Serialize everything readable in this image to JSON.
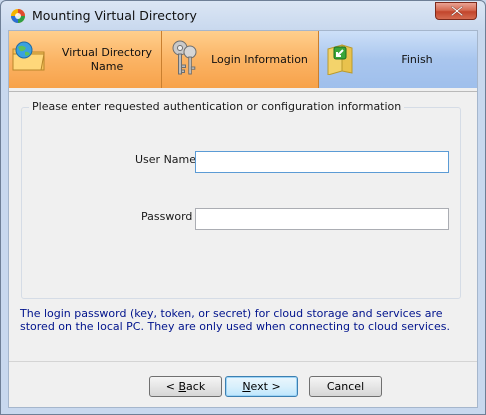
{
  "window": {
    "title": "Mounting Virtual Directory"
  },
  "steps": [
    {
      "label": "Virtual Directory Name",
      "icon": "folder-globe-icon",
      "state": "done"
    },
    {
      "label": "Login Information",
      "icon": "keys-icon",
      "state": "done"
    },
    {
      "label": "Finish",
      "icon": "finish-folder-icon",
      "state": "current"
    }
  ],
  "form": {
    "group_title": "Please enter requested authentication or configuration information",
    "username_label": "User Name",
    "username_value": "",
    "password_label": "Password",
    "password_value": ""
  },
  "info_text": "The login password (key, token, or secret) for cloud storage and services are stored on the local PC. They are only used when connecting to cloud services.",
  "buttons": {
    "back_prefix": "< ",
    "back_mnemonic": "B",
    "back_rest": "ack",
    "next_prefix": "",
    "next_mnemonic": "N",
    "next_rest": "ext >",
    "cancel": "Cancel"
  },
  "colors": {
    "step_done": "#fbb465",
    "step_current": "#a9c6ee",
    "info_text": "#00138c"
  }
}
